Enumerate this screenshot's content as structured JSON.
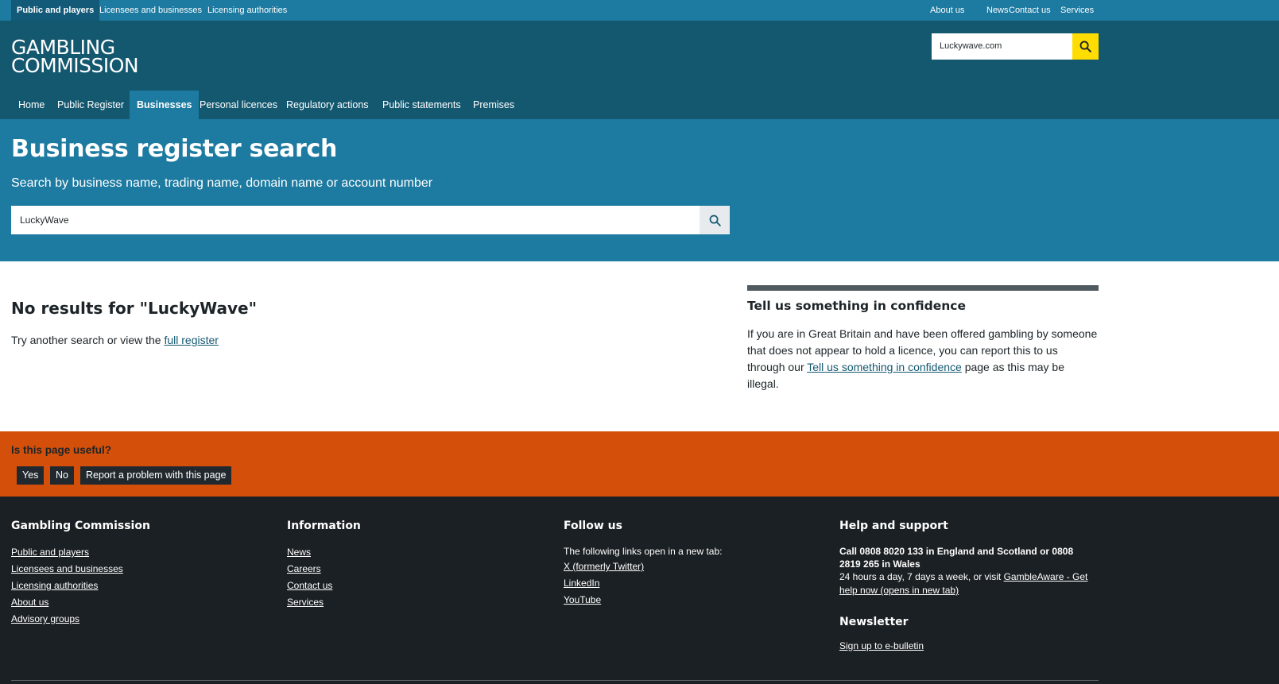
{
  "topbar": {
    "audiences": [
      "Public and players",
      "Licensees and businesses",
      "Licensing authorities"
    ],
    "utility": [
      "About us",
      "News",
      "Contact us",
      "Services"
    ]
  },
  "header": {
    "logo_line1": "GAMBLING",
    "logo_line2": "COMMISSION",
    "search_value": "Luckywave.com",
    "search_icon": "search-icon",
    "nav": [
      "Home",
      "Public Register",
      "Businesses",
      "Personal licences",
      "Regulatory actions",
      "Public statements",
      "Premises"
    ],
    "active_nav": "Businesses"
  },
  "hero": {
    "title": "Business register search",
    "subtitle": "Search by business name, trading name, domain name or account number",
    "search_value": "LuckyWave",
    "search_icon": "search-icon"
  },
  "results": {
    "heading": "No results for \"LuckyWave\"",
    "try_text": "Try another search or view the ",
    "full_register_link": "full register"
  },
  "confidence": {
    "title": "Tell us something in confidence",
    "text_before": "If you are in Great Britain and have been offered gambling by someone that does not appear to hold a licence, you can report this to us through our ",
    "link": "Tell us something in confidence",
    "text_after": " page as this may be illegal."
  },
  "feedback": {
    "question": "Is this page useful?",
    "yes": "Yes",
    "no": "No",
    "report": "Report a problem with this page"
  },
  "footer": {
    "col1": {
      "title": "Gambling Commission",
      "links": [
        "Public and players",
        "Licensees and businesses",
        "Licensing authorities",
        "About us",
        "Advisory groups"
      ]
    },
    "col2": {
      "title": "Information",
      "links": [
        "News",
        "Careers",
        "Contact us",
        "Services"
      ]
    },
    "col3": {
      "title": "Follow us",
      "note": "The following links open in a new tab:",
      "links": [
        "X (formerly Twitter)",
        "LinkedIn",
        "YouTube"
      ]
    },
    "col4": {
      "title": "Help and support",
      "call": "Call 0808 8020 133 in England and Scotland or 0808 2819 265 in Wales",
      "hours": "24 hours a day, 7 days a week, or visit ",
      "gambleaware": "GambleAware - Get help now (opens in new tab)",
      "newsletter_title": "Newsletter",
      "newsletter_link": "Sign up to e-bulletin"
    }
  },
  "colors": {
    "topbar": "#1d7aa0",
    "header": "#145870",
    "hero": "#1d7aa0",
    "search_button": "#ffdd00",
    "feedback": "#d4500a",
    "footer": "#1b2024"
  }
}
